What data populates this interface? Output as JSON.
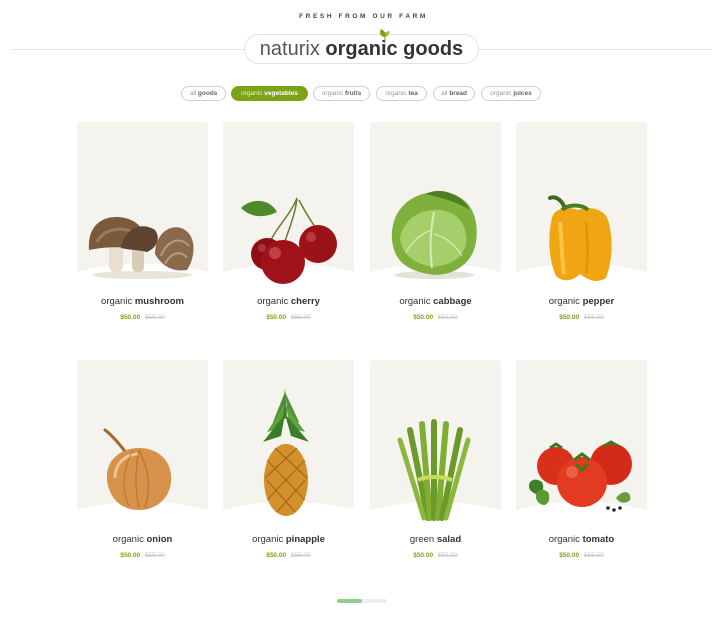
{
  "header": {
    "eyebrow": "FRESH FROM OUR FARM",
    "title_light": "naturix",
    "title_bold": "organic goods",
    "brand_color": "#7ca317"
  },
  "filters": [
    {
      "prefix": "all",
      "label": "goods",
      "active": false
    },
    {
      "prefix": "organic",
      "label": "vegetables",
      "active": true
    },
    {
      "prefix": "organic",
      "label": "fruits",
      "active": false
    },
    {
      "prefix": "organic",
      "label": "tea",
      "active": false
    },
    {
      "prefix": "all",
      "label": "bread",
      "active": false
    },
    {
      "prefix": "organic",
      "label": "juices",
      "active": false
    }
  ],
  "products": [
    {
      "prefix": "organic",
      "name": "mushroom",
      "price": "$50.00",
      "old_price": "$55.00",
      "icon": "mushroom-image"
    },
    {
      "prefix": "organic",
      "name": "cherry",
      "price": "$50.00",
      "old_price": "$55.00",
      "icon": "cherry-image"
    },
    {
      "prefix": "organic",
      "name": "cabbage",
      "price": "$50.00",
      "old_price": "$55.00",
      "icon": "cabbage-image"
    },
    {
      "prefix": "organic",
      "name": "pepper",
      "price": "$50.00",
      "old_price": "$55.00",
      "icon": "pepper-image"
    },
    {
      "prefix": "organic",
      "name": "onion",
      "price": "$50.00",
      "old_price": "$55.00",
      "icon": "onion-image"
    },
    {
      "prefix": "organic",
      "name": "pinapple",
      "price": "$50.00",
      "old_price": "$55.00",
      "icon": "pineapple-image"
    },
    {
      "prefix": "green",
      "name": "salad",
      "price": "$50.00",
      "old_price": "$55.00",
      "icon": "asparagus-image"
    },
    {
      "prefix": "organic",
      "name": "tomato",
      "price": "$50.00",
      "old_price": "$55.00",
      "icon": "tomato-image"
    }
  ],
  "pager": {
    "progress": 0.5
  }
}
